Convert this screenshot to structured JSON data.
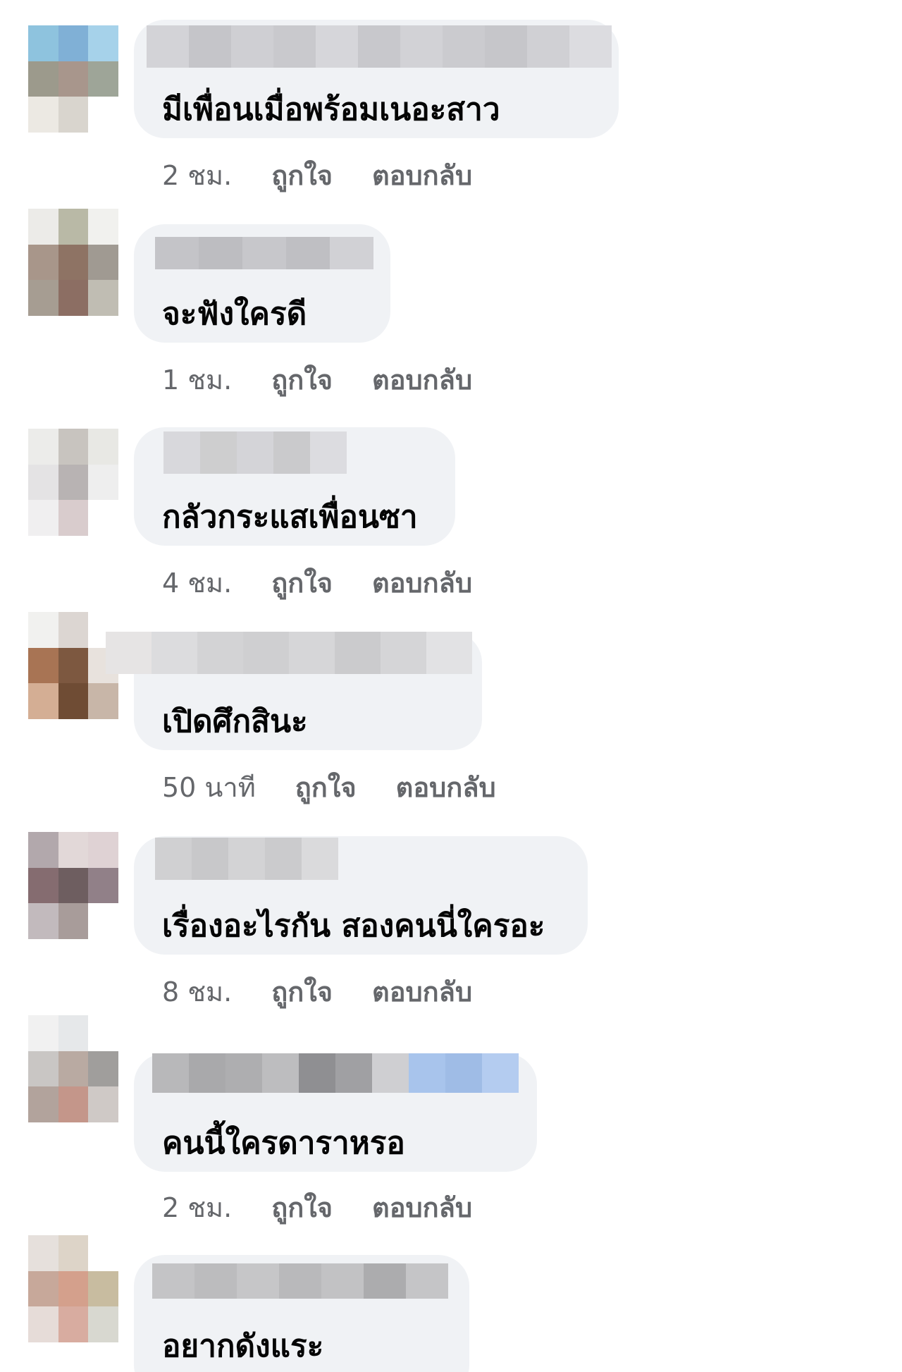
{
  "comments": [
    {
      "text": "มีเพื่อนเมื่อพร้อมเนอะสาว",
      "time": "2 ชม.",
      "like": "ถูกใจ",
      "reply": "ตอบกลับ"
    },
    {
      "text": "จะฟังใครดี",
      "time": "1 ชม.",
      "like": "ถูกใจ",
      "reply": "ตอบกลับ"
    },
    {
      "text": "กลัวกระแสเพื่อนซา",
      "time": "4 ชม.",
      "like": "ถูกใจ",
      "reply": "ตอบกลับ"
    },
    {
      "text": "เปิดศึกสินะ",
      "time": "50 นาที",
      "like": "ถูกใจ",
      "reply": "ตอบกลับ"
    },
    {
      "text": "เรื่องอะไรกัน สองคนนี่ใครอะ",
      "time": "8 ชม.",
      "like": "ถูกใจ",
      "reply": "ตอบกลับ"
    },
    {
      "text": "คนนี้ใครดาราหรอ",
      "time": "2 ชม.",
      "like": "ถูกใจ",
      "reply": "ตอบกลับ"
    },
    {
      "text": "อยากดังแระ"
    }
  ]
}
